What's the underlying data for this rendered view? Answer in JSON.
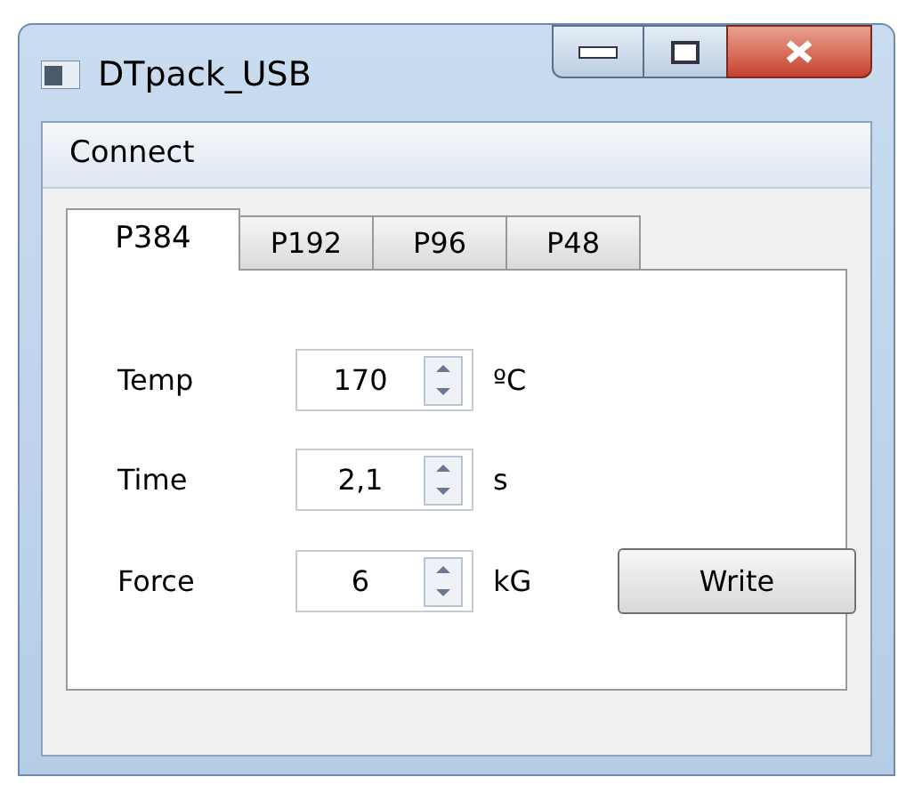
{
  "window": {
    "title": "DTpack_USB"
  },
  "menu": [
    "Connect"
  ],
  "tabs": [
    {
      "label": "P384",
      "selected": true
    },
    {
      "label": "P192",
      "selected": false
    },
    {
      "label": "P96",
      "selected": false
    },
    {
      "label": "P48",
      "selected": false
    }
  ],
  "fields": [
    {
      "label": "Temp",
      "value": "170",
      "unit": "ºC"
    },
    {
      "label": "Time",
      "value": "2,1",
      "unit": "s"
    },
    {
      "label": "Force",
      "value": "6",
      "unit": "kG"
    }
  ],
  "buttons": [
    "Write"
  ]
}
